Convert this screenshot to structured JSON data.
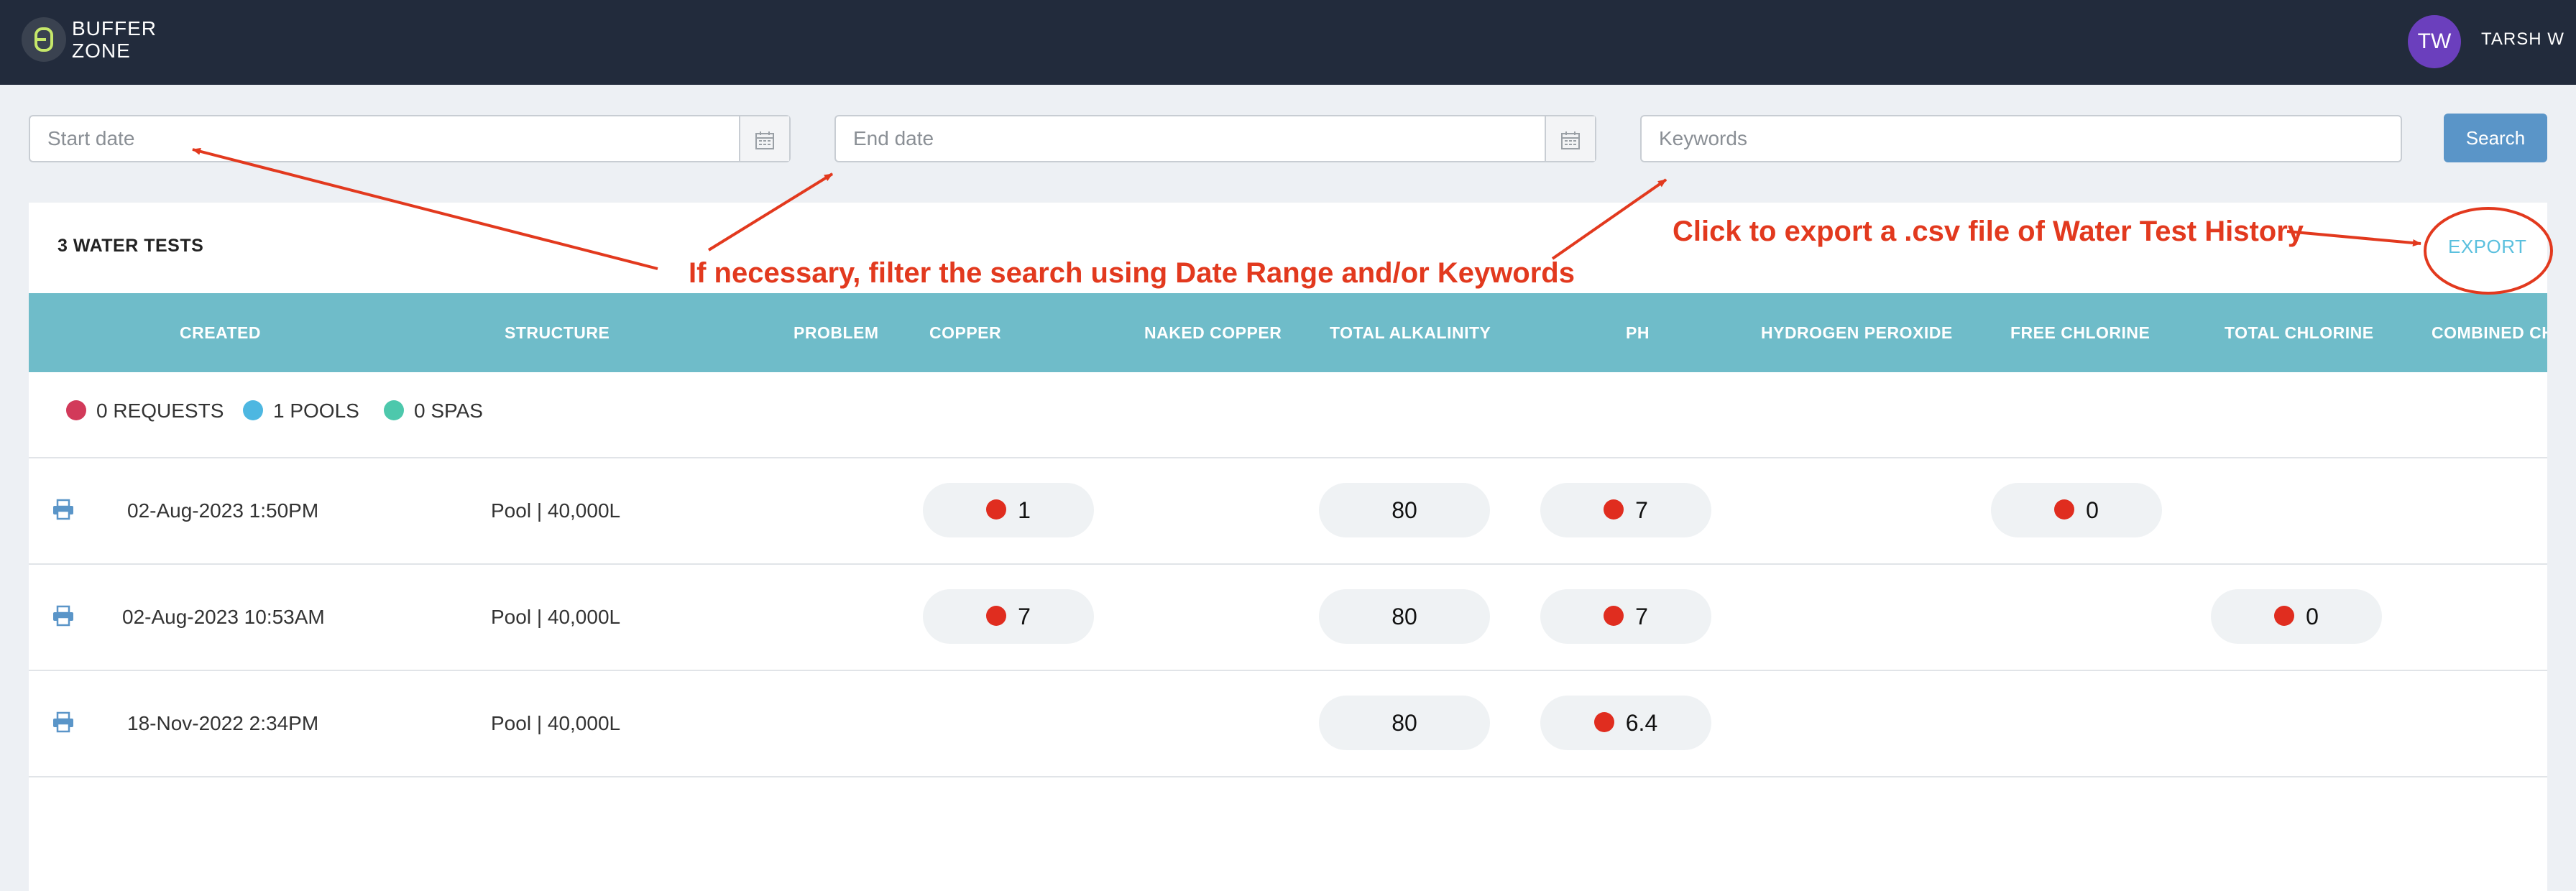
{
  "brand": {
    "name_line1": "BUFFER",
    "name_line2": "ZONE"
  },
  "user": {
    "initials": "TW",
    "name": "TARSH W"
  },
  "filters": {
    "start_placeholder": "Start date",
    "end_placeholder": "End date",
    "keywords_placeholder": "Keywords",
    "search_label": "Search"
  },
  "card": {
    "title": "3 WATER TESTS",
    "export_label": "EXPORT"
  },
  "columns": [
    "CREATED",
    "STRUCTURE",
    "PROBLEM",
    "COPPER",
    "NAKED COPPER",
    "TOTAL ALKALINITY",
    "PH",
    "HYDROGEN PEROXIDE",
    "FREE CHLORINE",
    "TOTAL CHLORINE",
    "COMBINED CH"
  ],
  "legend": [
    {
      "label": "0 REQUESTS",
      "color": "#d23a5a"
    },
    {
      "label": "1 POOLS",
      "color": "#4db7e1"
    },
    {
      "label": "0 SPAS",
      "color": "#4dc8ac"
    }
  ],
  "rows": [
    {
      "created": "02-Aug-2023 1:50PM",
      "structure": "Pool | 40,000L",
      "copper": "1",
      "total_alkalinity": "80",
      "ph": "7",
      "free_chlorine": "0",
      "total_chlorine": ""
    },
    {
      "created": "02-Aug-2023 10:53AM",
      "structure": "Pool | 40,000L",
      "copper": "7",
      "total_alkalinity": "80",
      "ph": "7",
      "free_chlorine": "",
      "total_chlorine": "0"
    },
    {
      "created": "18-Nov-2022 2:34PM",
      "structure": "Pool | 40,000L",
      "copper": "",
      "total_alkalinity": "80",
      "ph": "6.4",
      "free_chlorine": "",
      "total_chlorine": ""
    }
  ],
  "annotations": {
    "filter_hint": "If necessary, filter the search using Date Range and/or Keywords",
    "export_hint": "Click to export a .csv file of Water Test History"
  },
  "colors": {
    "nav_bg": "#222b3c",
    "header_bg": "#6fbcc9",
    "accent": "#5a95c8",
    "export": "#5bc0de",
    "alert_dot": "#e02d1f",
    "annotation": "#e2391e"
  }
}
